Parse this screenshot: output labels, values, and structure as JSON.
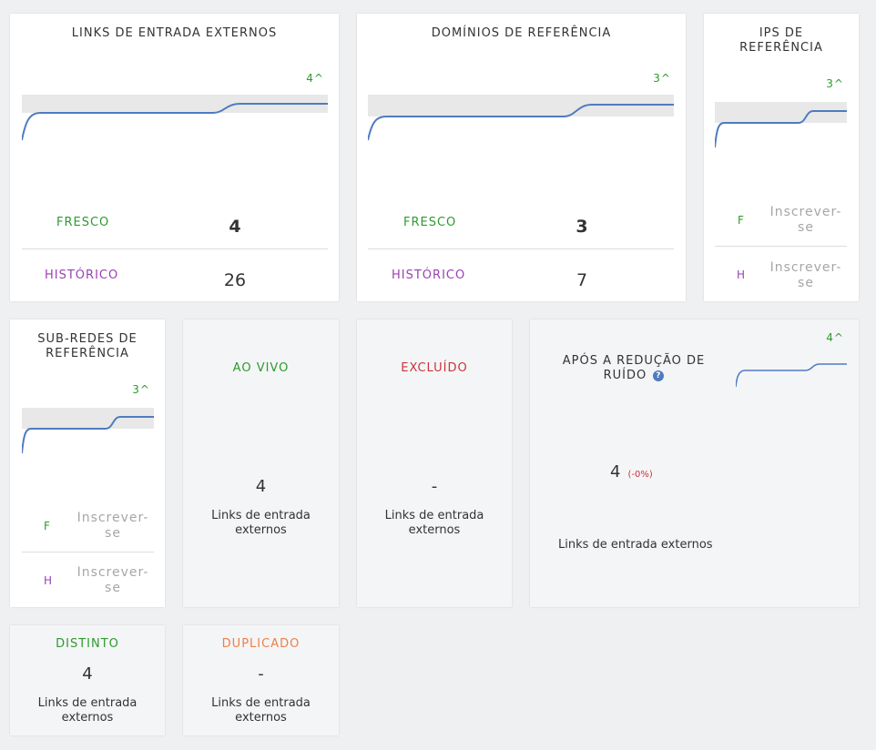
{
  "colors": {
    "green": "#2e9a2e",
    "purple": "#9b3fb5",
    "red": "#c9343a",
    "orange": "#ee8045",
    "sparkline": "#4f7bc0"
  },
  "external_links": {
    "title": "LINKS DE ENTRADA EXTERNOS",
    "delta": "4^",
    "fresh_label": "FRESCO",
    "fresh_value": "4",
    "historic_label": "HISTÓRICO",
    "historic_value": "26"
  },
  "ref_domains": {
    "title": "DOMÍNIOS DE REFERÊNCIA",
    "delta": "3^",
    "fresh_label": "FRESCO",
    "fresh_value": "3",
    "historic_label": "HISTÓRICO",
    "historic_value": "7"
  },
  "ref_ips": {
    "title_line1": "IPS DE",
    "title_line2": "REFERÊNCIA",
    "delta": "3^",
    "fresh_label": "F",
    "fresh_value_line1": "Inscrever-",
    "fresh_value_line2": "se",
    "historic_label": "H",
    "historic_value_line1": "Inscrever-",
    "historic_value_line2": "se"
  },
  "ref_subnets": {
    "title_line1": "SUB-REDES DE",
    "title_line2": "REFERÊNCIA",
    "delta": "3^",
    "fresh_label": "F",
    "fresh_value_line1": "Inscrever-",
    "fresh_value_line2": "se",
    "historic_label": "H",
    "historic_value_line1": "Inscrever-",
    "historic_value_line2": "se"
  },
  "live": {
    "title": "AO VIVO",
    "value": "4",
    "caption_line1": "Links de entrada",
    "caption_line2": "externos"
  },
  "deleted": {
    "title": "EXCLUÍDO",
    "value": "-",
    "caption_line1": "Links de entrada",
    "caption_line2": "externos"
  },
  "noise_reduction": {
    "title_line1": "APÓS A REDUÇÃO DE",
    "title_line2": "RUÍDO",
    "help_icon": "question-circle-icon",
    "delta": "4^",
    "value": "4",
    "change": "(-0%)",
    "caption": "Links de entrada externos"
  },
  "distinct": {
    "title": "DISTINTO",
    "value": "4",
    "caption_line1": "Links de entrada",
    "caption_line2": "externos"
  },
  "duplicate": {
    "title": "DUPLICADO",
    "value": "-",
    "caption_line1": "Links de entrada",
    "caption_line2": "externos"
  }
}
